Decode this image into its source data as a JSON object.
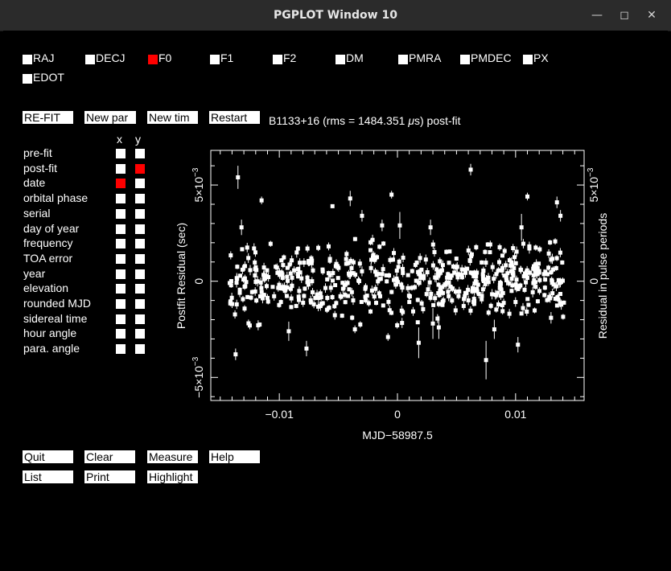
{
  "window": {
    "title": "PGPLOT Window 10"
  },
  "params": [
    {
      "label": "RAJ",
      "selected": false
    },
    {
      "label": "DECJ",
      "selected": false
    },
    {
      "label": "F0",
      "selected": true
    },
    {
      "label": "F1",
      "selected": false
    },
    {
      "label": "F2",
      "selected": false
    },
    {
      "label": "DM",
      "selected": false
    },
    {
      "label": "PMRA",
      "selected": false
    },
    {
      "label": "PMDEC",
      "selected": false
    },
    {
      "label": "PX",
      "selected": false
    },
    {
      "label": "EDOT",
      "selected": false
    }
  ],
  "top_buttons": [
    "RE-FIT",
    "New par",
    "New tim",
    "Restart"
  ],
  "plot_title": {
    "prefix": "B1133+16 (rms = 1484.351 ",
    "unit_symbol": "μ",
    "suffix": "s) post-fit"
  },
  "axis_headers": {
    "x": "x",
    "y": "y"
  },
  "options": [
    {
      "label": "pre-fit",
      "x": false,
      "y": false
    },
    {
      "label": "post-fit",
      "x": false,
      "y": true
    },
    {
      "label": "date",
      "x": true,
      "y": false
    },
    {
      "label": "orbital phase",
      "x": false,
      "y": false
    },
    {
      "label": "serial",
      "x": false,
      "y": false
    },
    {
      "label": "day of year",
      "x": false,
      "y": false
    },
    {
      "label": "frequency",
      "x": false,
      "y": false
    },
    {
      "label": "TOA error",
      "x": false,
      "y": false
    },
    {
      "label": "year",
      "x": false,
      "y": false
    },
    {
      "label": "elevation",
      "x": false,
      "y": false
    },
    {
      "label": "rounded MJD",
      "x": false,
      "y": false
    },
    {
      "label": "sidereal time",
      "x": false,
      "y": false
    },
    {
      "label": "hour angle",
      "x": false,
      "y": false
    },
    {
      "label": "para. angle",
      "x": false,
      "y": false
    }
  ],
  "bottom_buttons": [
    [
      "Quit",
      "Clear",
      "Measure",
      "Help"
    ],
    [
      "List",
      "Print",
      "Highlight"
    ]
  ],
  "colors": {
    "selected": "#ff0000",
    "background": "#000000",
    "foreground": "#ffffff"
  },
  "chart_data": {
    "type": "scatter",
    "title": "B1133+16 (rms = 1484.351 μs) post-fit",
    "xlabel": "MJD−58987.5",
    "ylabel": "Postfit Residual (sec)",
    "ylabel_right": "Residual in pulse periods",
    "xlim": [
      -0.0158,
      0.0158
    ],
    "ylim": [
      -0.0062,
      0.0068
    ],
    "x_ticks": [
      -0.01,
      0,
      0.01
    ],
    "x_tick_labels": [
      "−0.01",
      "0",
      "0.01"
    ],
    "y_tick_labels": [
      {
        "value": 0.005,
        "mantissa": "5×10",
        "exponent": "−3"
      },
      {
        "value": 0,
        "mantissa": "0",
        "exponent": ""
      },
      {
        "value": -0.005,
        "mantissa": "−5×10",
        "exponent": "−3"
      }
    ],
    "right_tick_labels": [
      {
        "value": 0.005,
        "mantissa": "5×10",
        "exponent": "−3"
      },
      {
        "value": 0,
        "mantissa": "0",
        "exponent": ""
      }
    ],
    "notable_points": [
      {
        "x": -0.0135,
        "y": 0.0054,
        "err": 0.0006
      },
      {
        "x": 0.0062,
        "y": 0.0058,
        "err": 0.0003
      },
      {
        "x": -0.0115,
        "y": 0.0042,
        "err": 0.0002
      },
      {
        "x": -0.004,
        "y": 0.0043,
        "err": 0.0004
      },
      {
        "x": -0.0005,
        "y": 0.0045,
        "err": 0.0002
      },
      {
        "x": -0.0055,
        "y": 0.0039,
        "err": 0.0001
      },
      {
        "x": 0.011,
        "y": 0.0044,
        "err": 0.0002
      },
      {
        "x": 0.0135,
        "y": 0.0041,
        "err": 0.0003
      },
      {
        "x": 0.0138,
        "y": 0.0034,
        "err": 0.0003
      },
      {
        "x": -0.0132,
        "y": 0.0028,
        "err": 0.0004
      },
      {
        "x": -0.003,
        "y": 0.0034,
        "err": 0.0003
      },
      {
        "x": -0.0013,
        "y": 0.0029,
        "err": 0.0003
      },
      {
        "x": 0.0002,
        "y": 0.0029,
        "err": 0.0007
      },
      {
        "x": 0.0028,
        "y": 0.0028,
        "err": 0.0004
      },
      {
        "x": 0.0105,
        "y": 0.0028,
        "err": 0.0007
      },
      {
        "x": -0.0137,
        "y": -0.0038,
        "err": 0.0003
      },
      {
        "x": -0.0077,
        "y": -0.0035,
        "err": 0.0004
      },
      {
        "x": 0.0075,
        "y": -0.0041,
        "err": 0.001
      },
      {
        "x": 0.0018,
        "y": -0.0032,
        "err": 0.0008
      },
      {
        "x": 0.0102,
        "y": -0.0033,
        "err": 0.0004
      },
      {
        "x": -0.0008,
        "y": -0.0029,
        "err": 0.0002
      },
      {
        "x": -0.0125,
        "y": -0.0023,
        "err": 0.0002
      },
      {
        "x": 0.0035,
        "y": -0.0024,
        "err": 0.0006
      },
      {
        "x": 0.003,
        "y": -0.0022,
        "err": 0.0008
      },
      {
        "x": 0.013,
        "y": -0.0019,
        "err": 0.0003
      },
      {
        "x": 0.0082,
        "y": -0.0025,
        "err": 0.0005
      },
      {
        "x": -0.0092,
        "y": -0.0026,
        "err": 0.0005
      },
      {
        "x": -0.0036,
        "y": -0.0025,
        "err": 0.0002
      }
    ],
    "cloud": {
      "count": 560,
      "x_range": [
        -0.0142,
        0.0142
      ],
      "y_sigma": 0.00095,
      "typical_err": 0.00018
    }
  }
}
